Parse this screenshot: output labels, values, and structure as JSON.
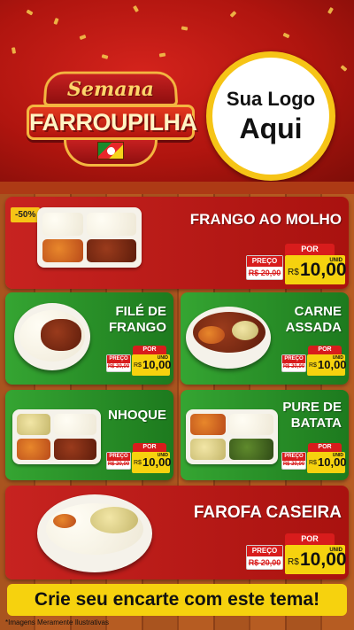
{
  "header": {
    "badge_line1": "Semana",
    "badge_line2": "FARROUPILHA",
    "logo_line1": "Sua Logo",
    "logo_line2": "Aqui"
  },
  "products": [
    {
      "name": "FRANGO AO MOLHO",
      "discount": "-50%",
      "por": "POR",
      "preco_label": "PREÇO",
      "old_price": "R$ 20,00",
      "currency": "R$",
      "price": "10,00",
      "unit": "UNID"
    },
    {
      "name_line1": "FILÉ DE",
      "name_line2": "FRANGO",
      "por": "POR",
      "preco_label": "PREÇO",
      "old_price": "R$ 20,00",
      "currency": "R$",
      "price": "10,00",
      "unit": "UNID"
    },
    {
      "name_line1": "CARNE",
      "name_line2": "ASSADA",
      "por": "POR",
      "preco_label": "PREÇO",
      "old_price": "R$ 20,00",
      "currency": "R$",
      "price": "10,00",
      "unit": "UNID"
    },
    {
      "name": "NHOQUE",
      "por": "POR",
      "preco_label": "PREÇO",
      "old_price": "R$ 20,00",
      "currency": "R$",
      "price": "10,00",
      "unit": "UNID"
    },
    {
      "name_line1": "PURE DE",
      "name_line2": "BATATA",
      "por": "POR",
      "preco_label": "PREÇO",
      "old_price": "R$ 20,00",
      "currency": "R$",
      "price": "10,00",
      "unit": "UNID"
    },
    {
      "name": "FAROFA CASEIRA",
      "por": "POR",
      "preco_label": "PREÇO",
      "old_price": "R$ 20,00",
      "currency": "R$",
      "price": "10,00",
      "unit": "UNID"
    }
  ],
  "footer": {
    "cta": "Crie seu encarte com este tema!",
    "disclaimer": "*Imagens Meramente Ilustrativas"
  },
  "colors": {
    "red": "#c72320",
    "green": "#2f9a2c",
    "yellow": "#f6d20e",
    "wood": "#a9541f"
  }
}
